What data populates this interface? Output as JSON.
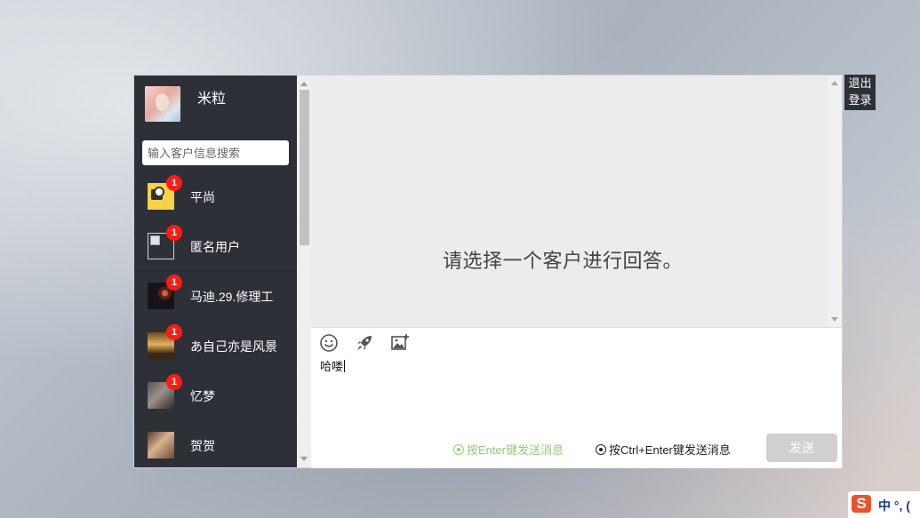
{
  "profile": {
    "name": "米粒"
  },
  "search": {
    "placeholder": "输入客户信息搜索"
  },
  "contacts": [
    {
      "name": "平尚",
      "badge": "1"
    },
    {
      "name": "匿名用户",
      "badge": "1"
    },
    {
      "name": "马迪.29.修理工",
      "badge": "1"
    },
    {
      "name": "あ自己亦是风景",
      "badge": "1"
    },
    {
      "name": "忆梦",
      "badge": "1"
    },
    {
      "name": "贺贺",
      "badge": ""
    }
  ],
  "messages": {
    "empty_text": "请选择一个客户进行回答。"
  },
  "composer": {
    "draft": "哈喽",
    "toolbar": [
      "smiley-icon",
      "rocket-icon",
      "image-icon"
    ],
    "send_options": {
      "enter": "按Enter键发送消息",
      "ctrl_enter": "按Ctrl+Enter键发送消息",
      "selected": "enter"
    },
    "send_label": "发送"
  },
  "header": {
    "logout_label": "退出登录"
  },
  "ime": {
    "text": "中 °, ("
  },
  "colors": {
    "sidebar": "#2e3038",
    "badge": "#ff1b14",
    "send_option_selected": "#8fcf71",
    "send_disabled": "#d0d0d0"
  }
}
